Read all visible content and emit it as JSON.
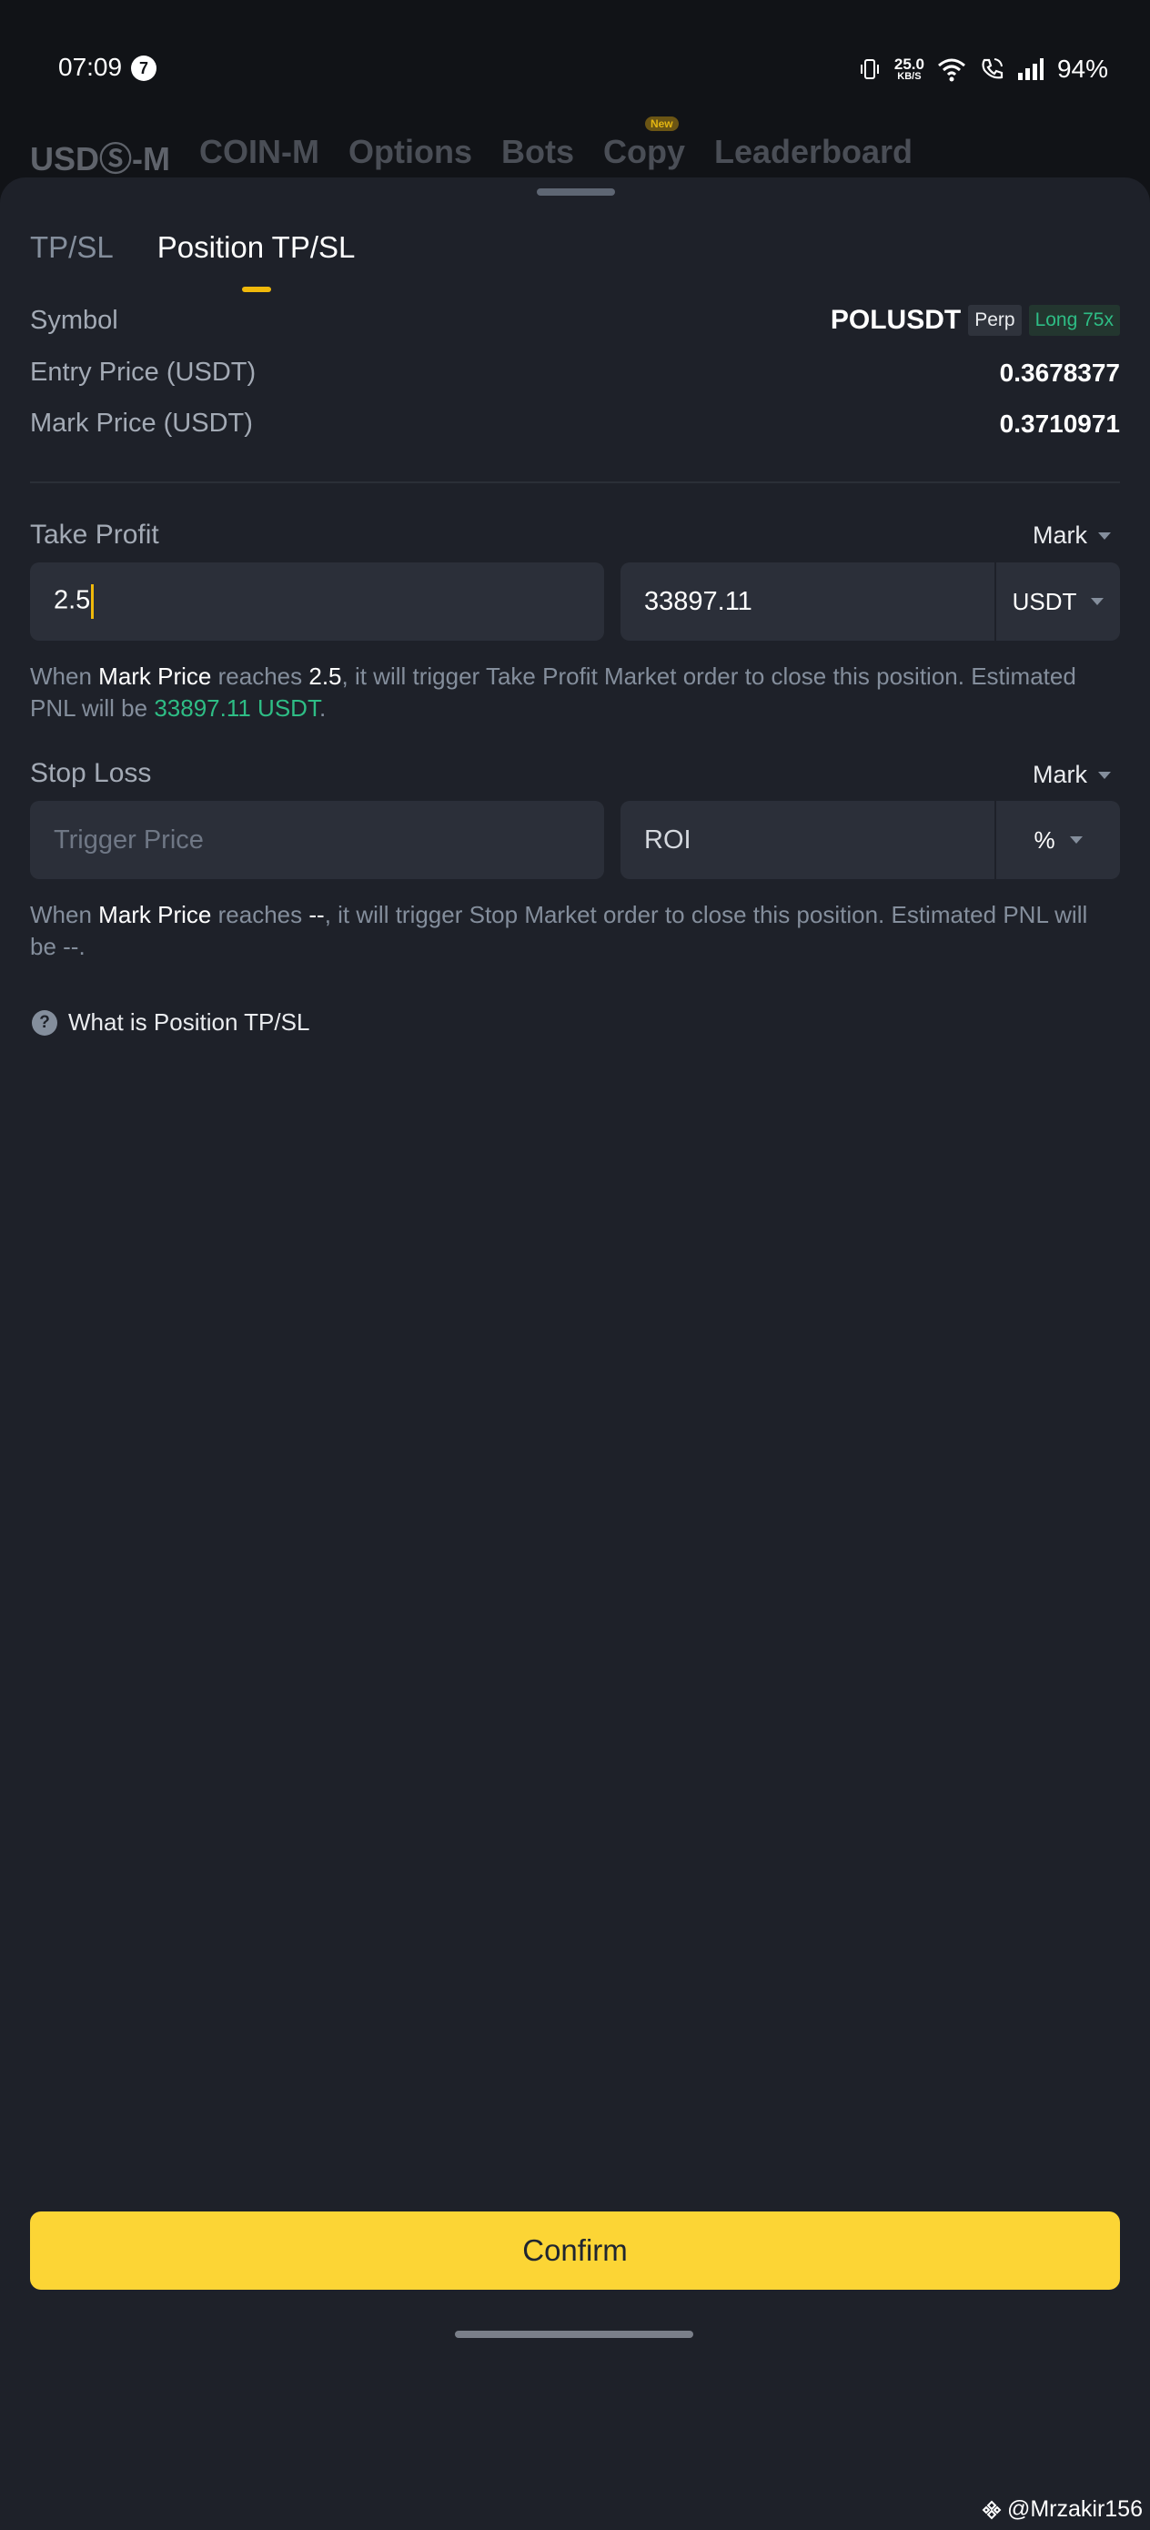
{
  "status_bar": {
    "time": "07:09",
    "notification_count": "7",
    "net_speed_value": "25.0",
    "net_speed_unit": "KB/S",
    "battery": "94%"
  },
  "top_nav": {
    "items": [
      "USDⓈ-M",
      "COIN-M",
      "Options",
      "Bots",
      "Copy",
      "Leaderboard"
    ],
    "new_badge": "New"
  },
  "tabs": [
    {
      "label": "TP/SL",
      "active": false
    },
    {
      "label": "Position TP/SL",
      "active": true
    }
  ],
  "position": {
    "symbol_label": "Symbol",
    "symbol": "POLUSDT",
    "contract_tag": "Perp",
    "side_tag": "Long 75x",
    "entry_label": "Entry Price (USDT)",
    "entry_value": "0.3678377",
    "mark_label": "Mark Price (USDT)",
    "mark_value": "0.3710971"
  },
  "take_profit": {
    "title": "Take Profit",
    "price_type": "Mark",
    "trigger_value": "2.5",
    "pnl_value": "33897.11",
    "unit": "USDT",
    "desc": {
      "p1": "When ",
      "mark": "Mark Price",
      "p2": " reaches ",
      "price": "2.5",
      "p3": ", it will trigger Take Profit Market order to close this position. Estimated PNL will be ",
      "pnl": "33897.11 USDT",
      "p4": "."
    }
  },
  "stop_loss": {
    "title": "Stop Loss",
    "price_type": "Mark",
    "trigger_placeholder": "Trigger Price",
    "roi_placeholder": "ROI",
    "unit": "%",
    "desc": {
      "p1": "When ",
      "mark": "Mark Price",
      "p2": " reaches ",
      "price": "--",
      "p3": ", it will trigger Stop Market order to close this position. Estimated PNL will be --."
    }
  },
  "help_link": "What is Position TP/SL",
  "confirm_label": "Confirm",
  "watermark": "@Mrzakir156",
  "colors": {
    "accent": "#f0b90b",
    "confirm_bg": "#fcd535",
    "profit_green": "#2ebd85",
    "sheet_bg": "#1e2129"
  }
}
